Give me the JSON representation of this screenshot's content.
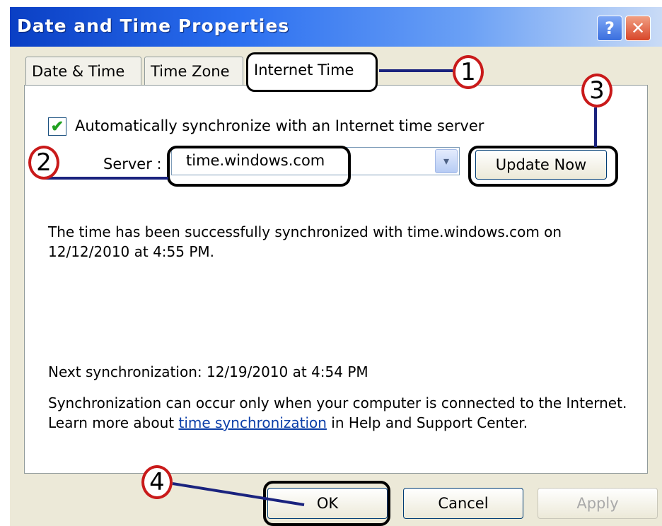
{
  "window": {
    "title": "Date and Time Properties",
    "help_glyph": "?",
    "close_glyph": "✕"
  },
  "tabs": [
    {
      "label": "Date & Time"
    },
    {
      "label": "Time Zone"
    },
    {
      "label": "Internet Time"
    }
  ],
  "auto_sync": {
    "checked": true,
    "check_glyph": "✔",
    "label": "Automatically synchronize with an Internet time server"
  },
  "server": {
    "label": "Server :",
    "value": "time.windows.com",
    "arrow_glyph": "▾"
  },
  "update_button": {
    "label": "Update Now"
  },
  "messages": {
    "sync_status": "The time has been successfully synchronized with time.windows.com on 12/12/2010 at 4:55 PM.",
    "next_sync": "Next synchronization: 12/19/2010 at 4:54 PM",
    "note_prefix": "Synchronization can occur only when your computer is connected to the Internet.  Learn more about ",
    "note_link": "time synchronization",
    "note_suffix": " in Help and Support Center."
  },
  "footer_buttons": {
    "ok": "OK",
    "cancel": "Cancel",
    "apply": "Apply"
  },
  "annotations": {
    "marker_1": "1",
    "marker_2": "2",
    "marker_3": "3",
    "marker_4": "4",
    "marker_color": "#c91a1a",
    "line_color": "#1a237e"
  }
}
